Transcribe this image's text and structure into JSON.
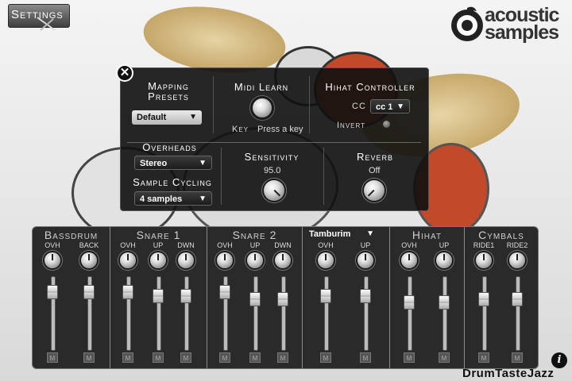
{
  "settings": {
    "label": "Settings"
  },
  "logo": {
    "line1": "acoustic",
    "line2": "samples"
  },
  "brand_footer": "DrumTasteJazz",
  "colors": {
    "panel_bg": "#101010",
    "cymbal": "#cdb27a",
    "drum_red": "#c24a2a"
  },
  "mapping_panel": {
    "close_icon": "close-icon",
    "mapping_presets": {
      "title_line1": "Mapping",
      "title_line2": "Presets",
      "selected": "Default"
    },
    "midi_learn": {
      "title": "Midi Learn",
      "key_label": "Key",
      "key_value": "Press a key"
    },
    "hihat_controller": {
      "title": "Hihat Controller",
      "cc_label": "CC",
      "cc_value": "cc 1",
      "invert_label": "Invert"
    },
    "overheads": {
      "title": "Overheads",
      "selected": "Stereo"
    },
    "sample_cycling": {
      "title": "Sample Cycling",
      "selected": "4 samples"
    },
    "sensitivity": {
      "title": "Sensitivity",
      "value": "95.0"
    },
    "reverb": {
      "title": "Reverb",
      "value": "Off"
    }
  },
  "mixer": {
    "mute_label": "M",
    "strips": [
      {
        "title": "Bassdrum",
        "channels": [
          {
            "label": "OVH",
            "level": 0.85
          },
          {
            "label": "BACK",
            "level": 0.85
          }
        ]
      },
      {
        "title": "Snare 1",
        "channels": [
          {
            "label": "OVH",
            "level": 0.85
          },
          {
            "label": "UP",
            "level": 0.79
          },
          {
            "label": "DWN",
            "level": 0.79
          }
        ]
      },
      {
        "title": "Snare 2",
        "channels": [
          {
            "label": "OVH",
            "level": 0.85
          },
          {
            "label": "UP",
            "level": 0.74
          },
          {
            "label": "DWN",
            "level": 0.74
          }
        ]
      },
      {
        "title": "Tamburim",
        "is_dropdown": true,
        "channels": [
          {
            "label": "OVH",
            "level": 0.79
          },
          {
            "label": "UP",
            "level": 0.79
          }
        ]
      },
      {
        "title": "Hihat",
        "channels": [
          {
            "label": "OVH",
            "level": 0.68
          },
          {
            "label": "UP",
            "level": 0.68
          }
        ]
      },
      {
        "title": "Cymbals",
        "channels": [
          {
            "label": "RIDE1",
            "level": 0.74
          },
          {
            "label": "RIDE2",
            "level": 0.74
          }
        ]
      }
    ]
  }
}
